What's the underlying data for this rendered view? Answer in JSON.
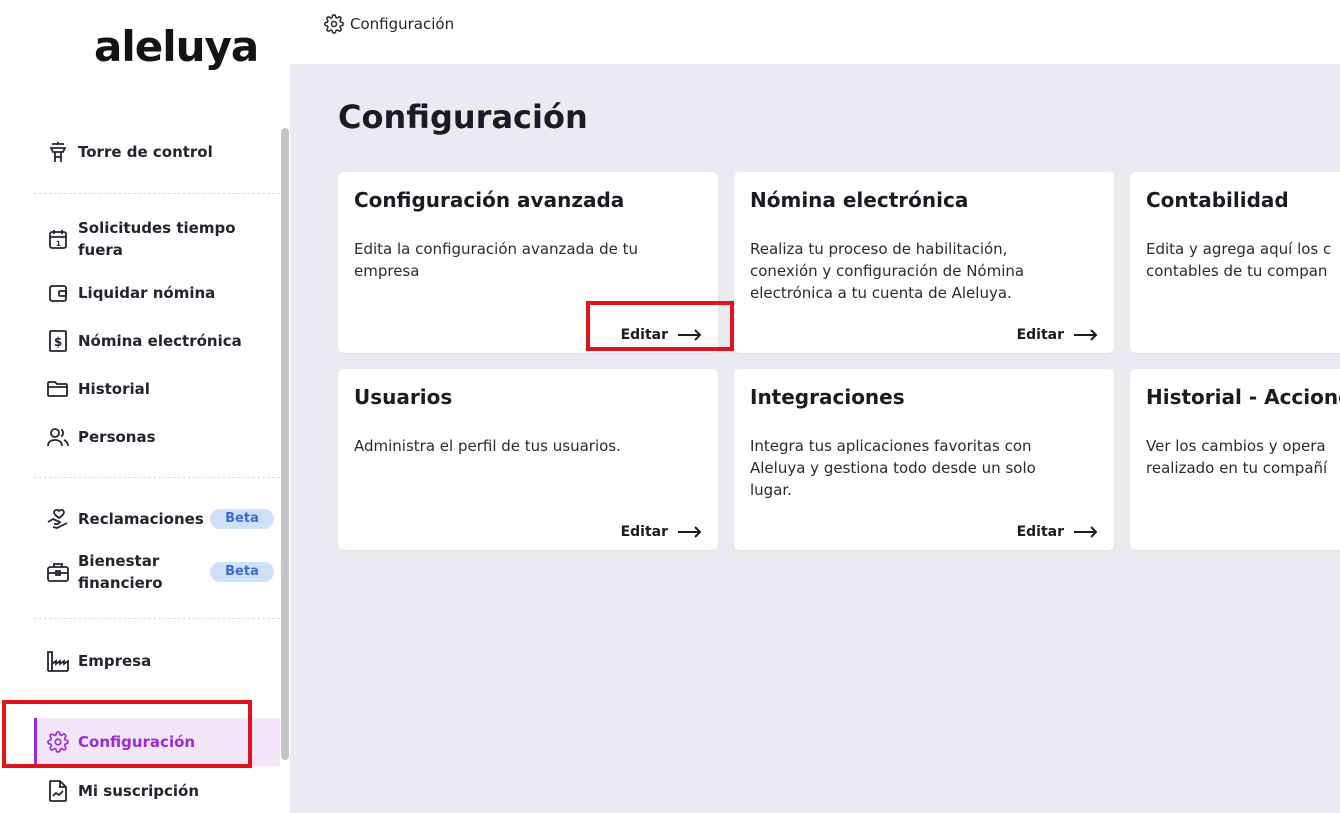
{
  "brand": {
    "logo_text": "aleluya"
  },
  "topbar": {
    "breadcrumb": "Configuración",
    "icon": "gear-icon"
  },
  "sidebar": {
    "items": [
      {
        "label": "Torre de control",
        "icon": "control-tower-icon"
      },
      {
        "label": "Solicitudes tiempo fuera",
        "icon": "calendar-icon"
      },
      {
        "label": "Liquidar nómina",
        "icon": "wallet-icon"
      },
      {
        "label": "Nómina electrónica",
        "icon": "invoice-dollar-icon"
      },
      {
        "label": "Historial",
        "icon": "folder-icon"
      },
      {
        "label": "Personas",
        "icon": "users-icon"
      },
      {
        "label": "Reclamaciones",
        "icon": "hand-heart-icon",
        "badge": "Beta"
      },
      {
        "label": "Bienestar financiero",
        "icon": "briefcase-icon",
        "badge": "Beta"
      },
      {
        "label": "Empresa",
        "icon": "factory-icon"
      },
      {
        "label": "Configuración",
        "icon": "gear-icon",
        "active": true
      },
      {
        "label": "Mi suscripción",
        "icon": "document-chart-icon"
      }
    ]
  },
  "main": {
    "title": "Configuración",
    "cards": [
      {
        "title": "Configuración avanzada",
        "description": "Edita la configuración avanzada de tu\nempresa",
        "action": "Editar"
      },
      {
        "title": "Nómina electrónica",
        "description": "Realiza tu proceso de habilitación,\nconexión y configuración de Nómina\nelectrónica a tu cuenta de Aleluya.",
        "action": "Editar"
      },
      {
        "title": "Contabilidad",
        "description": "Edita y agrega aquí los c\ncontables de tu compan",
        "action": ""
      },
      {
        "title": "Usuarios",
        "description": "Administra el perfil de tus usuarios.",
        "action": "Editar"
      },
      {
        "title": "Integraciones",
        "description": "Integra tus aplicaciones favoritas con\nAleluya y gestiona todo desde un solo\nlugar.",
        "action": "Editar"
      },
      {
        "title": "Historial - Accione",
        "description": "Ver los cambios y opera\nrealizado en tu compañí",
        "action": ""
      }
    ]
  },
  "colors": {
    "accent": "#9b2ad1",
    "highlight": "#e0141b",
    "badge_bg": "#cfe0fb",
    "badge_text": "#3a6fd0",
    "main_bg": "#ebebef"
  }
}
